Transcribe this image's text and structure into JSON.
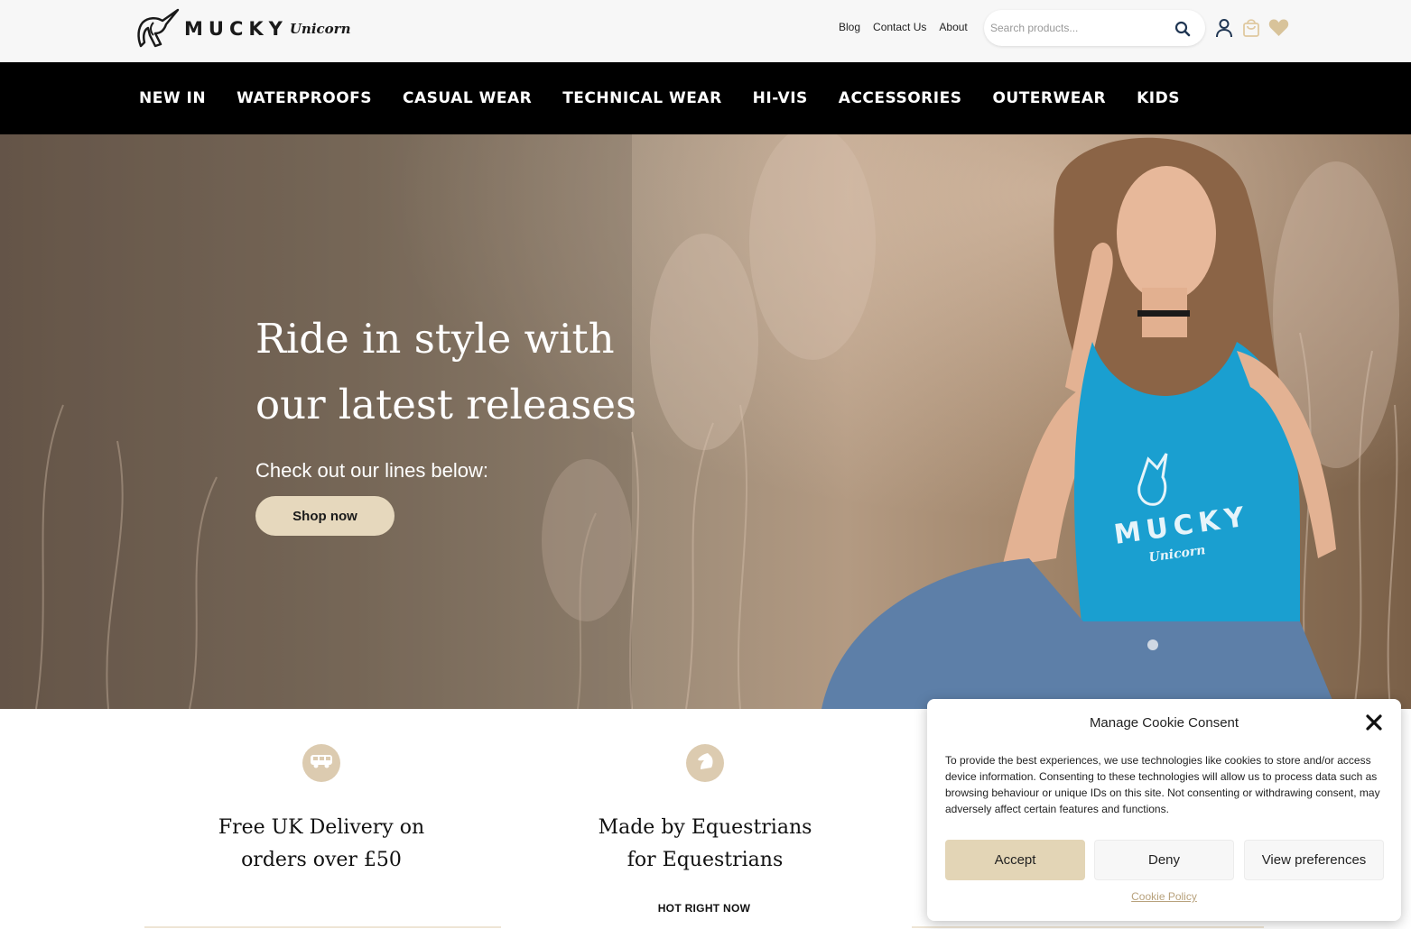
{
  "header": {
    "logo_text": "MUCKY",
    "logo_script": "Unicorn",
    "links": [
      "Blog",
      "Contact Us",
      "About"
    ],
    "search_placeholder": "Search products..."
  },
  "nav": {
    "items": [
      "NEW IN",
      "WATERPROOFS",
      "CASUAL WEAR",
      "TECHNICAL WEAR",
      "HI-VIS",
      "ACCESSORIES",
      "OUTERWEAR",
      "KIDS"
    ]
  },
  "hero": {
    "title_line1": "Ride in style with",
    "title_line2": "our latest releases",
    "subtitle": "Check out our lines below:",
    "cta": "Shop now",
    "shirt_print": "MUCKY",
    "shirt_print_script": "Unicorn"
  },
  "features": [
    {
      "line1": "Free UK Delivery on",
      "line2": "orders over £50",
      "icon": "van-icon"
    },
    {
      "line1": "Made by Equestrians",
      "line2": "for Equestrians",
      "icon": "horse-head-icon"
    }
  ],
  "section_label": "HOT RIGHT NOW",
  "cookie": {
    "title": "Manage Cookie Consent",
    "text": "To provide the best experiences, we use technologies like cookies to store and/or access device information. Consenting to these technologies will allow us to process data such as browsing behaviour or unique IDs on this site. Not consenting or withdrawing consent, may adversely affect certain features and functions.",
    "accept": "Accept",
    "deny": "Deny",
    "preferences": "View preferences",
    "policy_link": "Cookie Policy"
  },
  "colors": {
    "accent_beige": "#e6d8bd",
    "icon_circle": "#dccbb0",
    "nav_bg": "#000000",
    "link_gold": "#b8a27d",
    "shirt_blue": "#1a9fd0"
  }
}
